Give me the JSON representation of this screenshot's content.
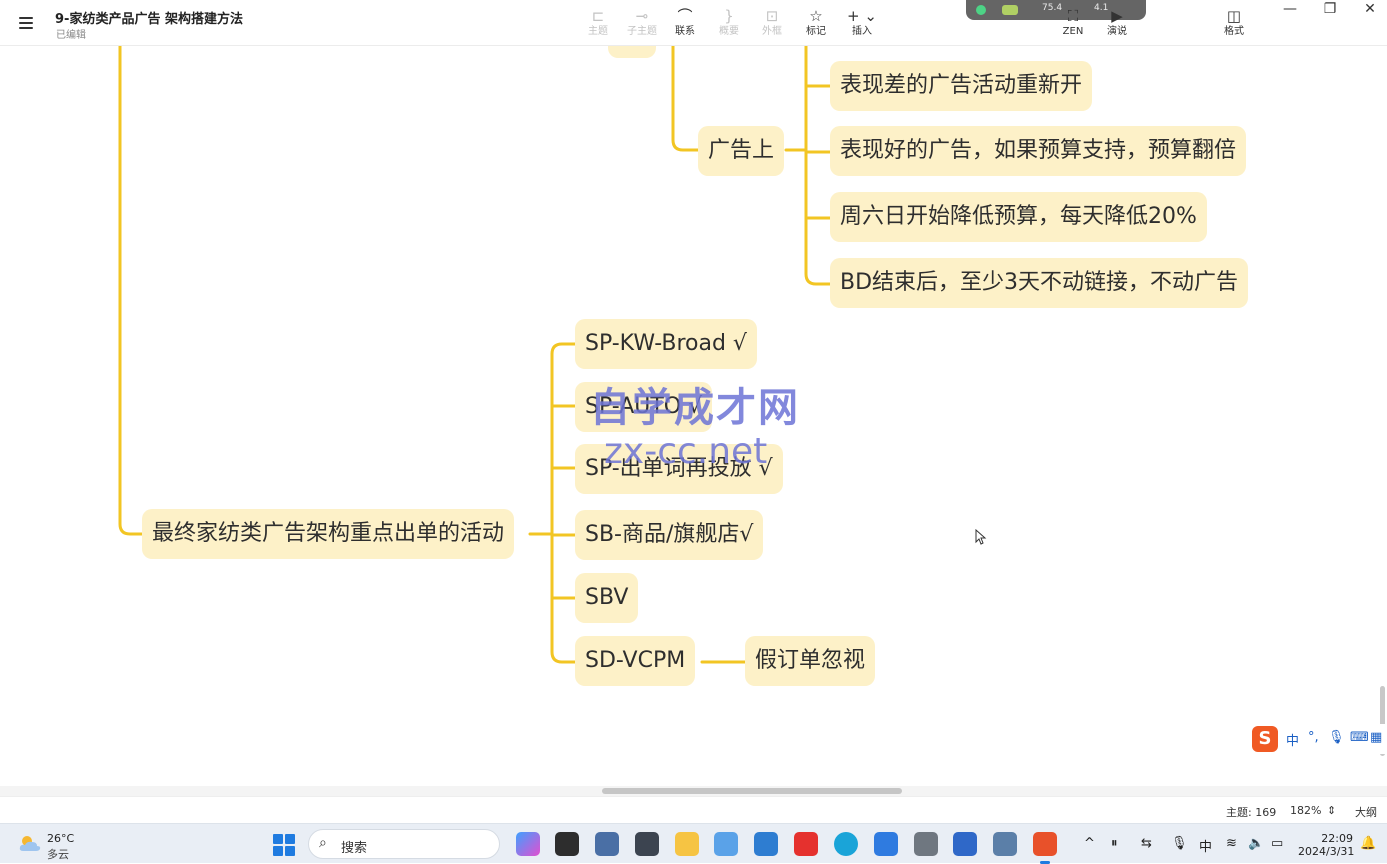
{
  "window": {
    "title": "9-家纺类产品广告 架构搭建方法",
    "status": "已编辑",
    "controls": {
      "minimize": "—",
      "maximize": "❐",
      "close": "✕"
    }
  },
  "toolbar": {
    "items": [
      {
        "label": "主题",
        "icon": "subtopic-icon",
        "glyph": "⊏",
        "enabled": false
      },
      {
        "label": "子主题",
        "icon": "child-topic-icon",
        "glyph": "⊸",
        "enabled": false
      },
      {
        "label": "联系",
        "icon": "relationship-icon",
        "glyph": "⌒",
        "enabled": true
      },
      {
        "label": "概要",
        "icon": "summary-icon",
        "glyph": "}",
        "enabled": false
      },
      {
        "label": "外框",
        "icon": "boundary-icon",
        "glyph": "⊡",
        "enabled": false
      },
      {
        "label": "标记",
        "icon": "star-icon",
        "glyph": "☆",
        "enabled": true
      },
      {
        "label": "插入",
        "icon": "plus-icon",
        "glyph": "+ ⌄",
        "enabled": true
      }
    ],
    "zen": {
      "label": "ZEN",
      "glyph": "⛶"
    },
    "present": {
      "label": "演说",
      "glyph": "▶"
    },
    "format": {
      "label": "格式",
      "glyph": "◫"
    }
  },
  "floating_widget": {
    "cpu": "75.4",
    "mem": "4.1"
  },
  "mindmap": {
    "nodes": {
      "n_ad_on": "广告上",
      "n_ad_on_1": "表现差的广告活动重新开",
      "n_ad_on_2": "表现好的广告，如果预算支持，预算翻倍",
      "n_ad_on_3": "周六日开始降低预算，每天降低20%",
      "n_ad_on_4": "BD结束后，至少3天不动链接，不动广告",
      "n_final": "最终家纺类广告架构重点出单的活动",
      "n_sp_kw": "SP-KW-Broad √",
      "n_sp_auto": "SP-AUTO √",
      "n_sp_order": "SP-出单词再投放 √",
      "n_sb": "SB-商品/旗舰店√",
      "n_sbv": "SBV",
      "n_sd": "SD-VCPM",
      "n_fake": "假订单忽视"
    },
    "branch_color": "#f2c523",
    "node_color": "#fdf1c8"
  },
  "watermark": {
    "line1": "自学成才网",
    "line2": "zx-cc.net"
  },
  "ime": {
    "logo": "S",
    "mode": "中",
    "punct": "°,",
    "mic": "🎙",
    "keyboard": "⌨",
    "grid": "▦"
  },
  "statusbar": {
    "topics": "主题: 169",
    "zoom": "182%",
    "outline": "大纲"
  },
  "taskbar": {
    "weather_temp": "26°C",
    "weather_desc": "多云",
    "search_placeholder": "搜索",
    "search_icon": "⌕",
    "time": "22:09",
    "date": "2024/3/31",
    "tray": {
      "chevron": "^",
      "lang": "中"
    }
  }
}
